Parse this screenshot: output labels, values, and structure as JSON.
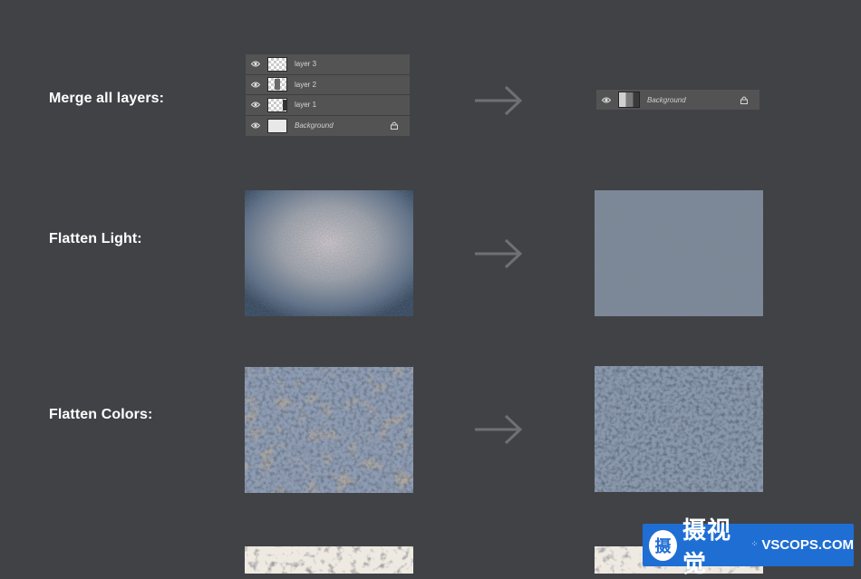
{
  "rows": {
    "merge": {
      "label": "Merge all layers:"
    },
    "light": {
      "label": "Flatten Light:"
    },
    "colors": {
      "label": "Flatten Colors:"
    }
  },
  "layers_before": [
    {
      "name": "layer 3",
      "thumb": "checker"
    },
    {
      "name": "layer 2",
      "thumb": "checker-dark"
    },
    {
      "name": "layer 1",
      "thumb": "checker-dark"
    },
    {
      "name": "Background",
      "thumb": "plain",
      "locked": true
    }
  ],
  "layers_after": [
    {
      "name": "Background",
      "locked": true
    }
  ],
  "icons": {
    "eye": "eye-icon",
    "lock": "lock-icon",
    "arrow": "arrow-right-icon"
  },
  "watermark": {
    "logo_char": "摄",
    "chinese": "摄视觉",
    "brand": "VSCOPS.COM"
  },
  "colors": {
    "background": "#414246",
    "panel": "#535353",
    "arrow": "#6f7074",
    "badge": "#1f6ed4"
  }
}
